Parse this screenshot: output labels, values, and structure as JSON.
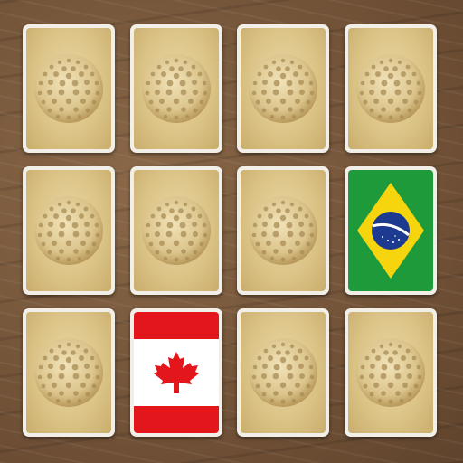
{
  "game": {
    "board_color": "#7b5a3e",
    "card_border_color": "#f2efe8",
    "card_back_color": "#dcc488",
    "card_back_icon": "golf-ball-icon",
    "cards": [
      {
        "state": "face-down",
        "row": 1,
        "col": 1
      },
      {
        "state": "face-down",
        "row": 1,
        "col": 2
      },
      {
        "state": "face-down",
        "row": 1,
        "col": 3
      },
      {
        "state": "face-down",
        "row": 1,
        "col": 4
      },
      {
        "state": "face-down",
        "row": 2,
        "col": 1
      },
      {
        "state": "face-down",
        "row": 2,
        "col": 2
      },
      {
        "state": "face-down",
        "row": 2,
        "col": 3
      },
      {
        "state": "face-up",
        "row": 2,
        "col": 4,
        "face": "brazil-flag"
      },
      {
        "state": "face-down",
        "row": 3,
        "col": 1
      },
      {
        "state": "face-up",
        "row": 3,
        "col": 2,
        "face": "canada-flag"
      },
      {
        "state": "face-down",
        "row": 3,
        "col": 3
      },
      {
        "state": "face-down",
        "row": 3,
        "col": 4
      }
    ]
  }
}
